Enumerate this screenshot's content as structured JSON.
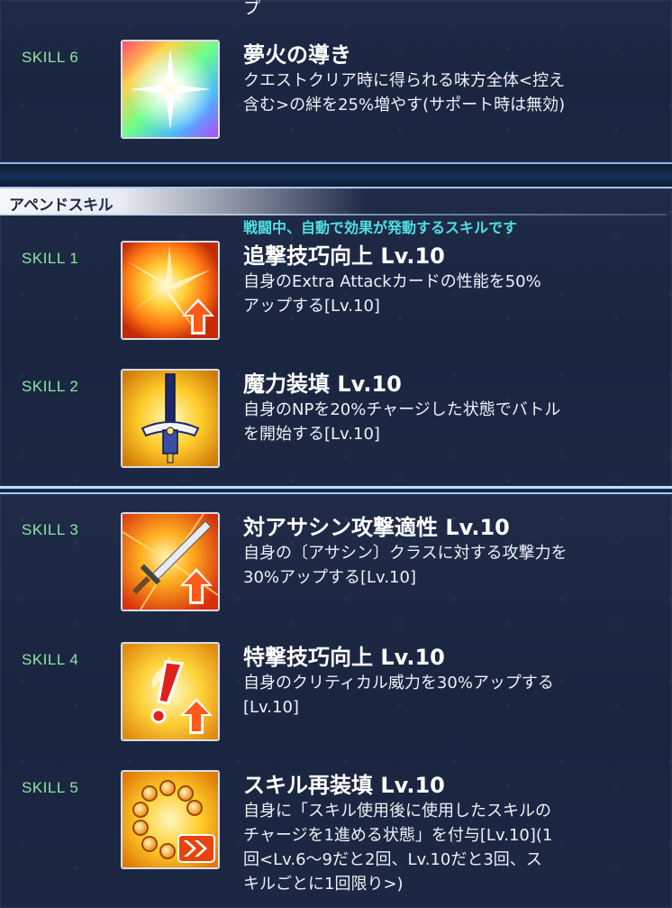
{
  "top_section": {
    "cut_text": "プ",
    "skill": {
      "label": "SKILL 6",
      "name": "夢火の導き",
      "desc_lines": [
        "クエストクリア時に得られる味方全体<控え",
        "含む>の絆を25%増やす(サポート時は無効)"
      ],
      "icon": "rainbow-starburst-icon"
    }
  },
  "append_section": {
    "title": "アペンドスキル",
    "description": "戦闘中、自動で効果が発動するスキルです",
    "skills": [
      {
        "label": "SKILL 1",
        "name": "追撃技巧向上 Lv.10",
        "desc_lines": [
          "自身のExtra Attackカードの性能を50%",
          "アップする[Lv.10]"
        ],
        "icon": "extra-attack-up-icon"
      },
      {
        "label": "SKILL 2",
        "name": "魔力装填 Lv.10",
        "desc_lines": [
          "自身のNPを20%チャージした状態でバトル",
          "を開始する[Lv.10]"
        ],
        "icon": "sword-charge-icon"
      }
    ]
  },
  "lower_section": {
    "skills": [
      {
        "label": "SKILL 3",
        "name": "対アサシン攻撃適性 Lv.10",
        "desc_lines": [
          "自身の〔アサシン〕クラスに対する攻撃力を",
          "30%アップする[Lv.10]"
        ],
        "icon": "sword-attack-up-icon"
      },
      {
        "label": "SKILL 4",
        "name": "特撃技巧向上 Lv.10",
        "desc_lines": [
          "自身のクリティカル威力を30%アップする",
          "[Lv.10]"
        ],
        "icon": "critical-up-icon"
      },
      {
        "label": "SKILL 5",
        "name": "スキル再装填 Lv.10",
        "desc_lines": [
          "自身に「スキル使用後に使用したスキルの",
          "チャージを1進める状態」を付与[Lv.10](1",
          "回<Lv.6～9だと2回、Lv.10だと3回、ス",
          "キルごとに1回限り>)"
        ],
        "icon": "skill-reload-icon"
      }
    ]
  },
  "colors": {
    "skill_label": "#8ee6a0",
    "header_desc": "#4fe0e6",
    "panel_bg": "#1c2843",
    "text": "#ffffff"
  }
}
